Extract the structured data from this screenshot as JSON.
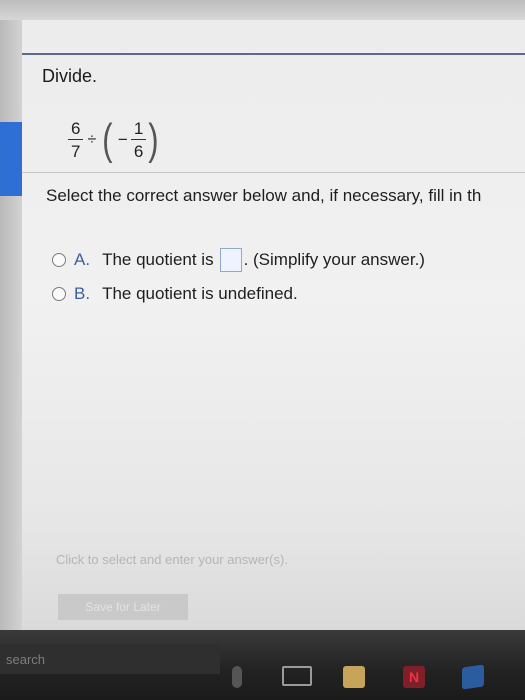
{
  "question": {
    "instruction": "Divide.",
    "expression": {
      "fraction1": {
        "numerator": "6",
        "denominator": "7"
      },
      "operator": "÷",
      "open_paren": "(",
      "sign": "−",
      "fraction2": {
        "numerator": "1",
        "denominator": "6"
      },
      "close_paren": ")"
    }
  },
  "prompt": "Select the correct answer below and, if necessary, fill in th",
  "options": [
    {
      "letter": "A.",
      "text_before": "The quotient is",
      "text_after": ". (Simplify your answer.)",
      "value": ""
    },
    {
      "letter": "B.",
      "text": "The quotient is undefined."
    }
  ],
  "footer": {
    "hint": "Click to select and enter your answer(s).",
    "save_label": "Save for Later"
  },
  "taskbar": {
    "search_label": "search"
  },
  "colors": {
    "accent": "#2e6fd4",
    "header_line": "#5a6b8e",
    "option_letter": "#3b5fa6"
  }
}
